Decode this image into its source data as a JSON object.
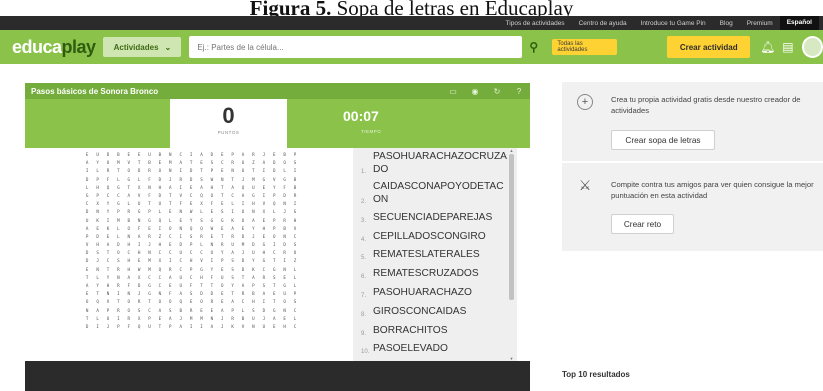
{
  "caption": {
    "prefix": "Figura 5.",
    "text": " Sopa de letras en Educaplay"
  },
  "topbar": {
    "links": [
      "Tipos de actividades",
      "Centro de ayuda",
      "Introduce tu Game Pin",
      "Blog",
      "Premium"
    ],
    "language": "Español"
  },
  "navbar": {
    "logo_main": "educa",
    "logo_accent": "play",
    "activities_label": "Actividades",
    "search_placeholder": "Ej.: Partes de la célula...",
    "all_activities_label": "Todas las actividades",
    "create_label": "Crear actividad"
  },
  "game": {
    "title": "Pasos básicos de Sonora Bronco",
    "points_value": "0",
    "points_label": "PUNTOS",
    "timer_value": "00:07",
    "timer_label": "TIEMPO",
    "grid": [
      "EUDBEEUBNCIADEPARJEBP",
      "AYUMVTBEMATESCRUZADOS",
      "ILRTODRONIDTPENUTIDLI",
      "DPFLGLFDJRDSWNTJMGVGB",
      "LHQGTXNHAIEAHTAQUEYFB",
      "GPCCAVFDTVCQOTCAGIPDR",
      "CXYGLUTUTFEXFELIHVQNI",
      "DNYPRGPLENWLESIONXLJG",
      "UKIMBNGQLEYSGGKUAEPRH",
      "AEKLOFEIONQQWEAEYHPBV",
      "PDELNARZCISRETRDJEONC",
      "VHADHIJHEDPLNRUMDGIDS",
      "DSTOCHNCCUCCUYAJUHCRO",
      "DJCSHEMXICHVIPSDYGTIZ",
      "ENTRHWMQRCPGYESDKCGNL",
      "TLYNAXCCAUCHFUSTARSEL",
      "AYHRFDGCEUFTTOYAPSTGL",
      "ETNINJGNFASDDETRBAEUP",
      "OQVTORTOOQEOREACHITOS",
      "NAPROSCASBREEAPLSDGNC",
      "TLUIRXPEAJMMNJRBUJAEL",
      "DIJPFQUTPAIIAJKVNUEHC"
    ],
    "words": [
      {
        "num": "1.",
        "text": "PASOHUARACHAZOCRUZADO"
      },
      {
        "num": "2.",
        "text": "CAIDASCONAPOYODETACON"
      },
      {
        "num": "3.",
        "text": "SECUENCIADEPAREJAS"
      },
      {
        "num": "4.",
        "text": "CEPILLADOSCONGIRO"
      },
      {
        "num": "5.",
        "text": "REMATESLATERALES"
      },
      {
        "num": "6.",
        "text": "REMATESCRUZADOS"
      },
      {
        "num": "7.",
        "text": "PASOHUARACHAZO"
      },
      {
        "num": "8.",
        "text": "GIROSCONCAIDAS"
      },
      {
        "num": "9.",
        "text": "BORRACHITOS"
      },
      {
        "num": "10.",
        "text": "PASOELEVADO"
      }
    ]
  },
  "sidebar": {
    "create_text": "Crea tu propia actividad gratis desde nuestro creador de actividades",
    "create_button": "Crear sopa de letras",
    "challenge_text": "Compite contra tus amigos para ver quien consigue la mejor puntuación en esta actividad",
    "challenge_button": "Crear reto",
    "top10_label": "Top 10 resultados"
  },
  "colors": {
    "brand_green": "#8bc34a",
    "header_green": "#74ad3c",
    "accent_yellow": "#ffd233",
    "dark": "#2b2b2b"
  },
  "icons": [
    "search-icon",
    "bell-icon",
    "chat-icon",
    "avatar",
    "fullscreen-icon",
    "eye-icon",
    "refresh-icon",
    "help-icon",
    "plus-circle-icon",
    "swords-icon",
    "chevron-down-icon"
  ]
}
